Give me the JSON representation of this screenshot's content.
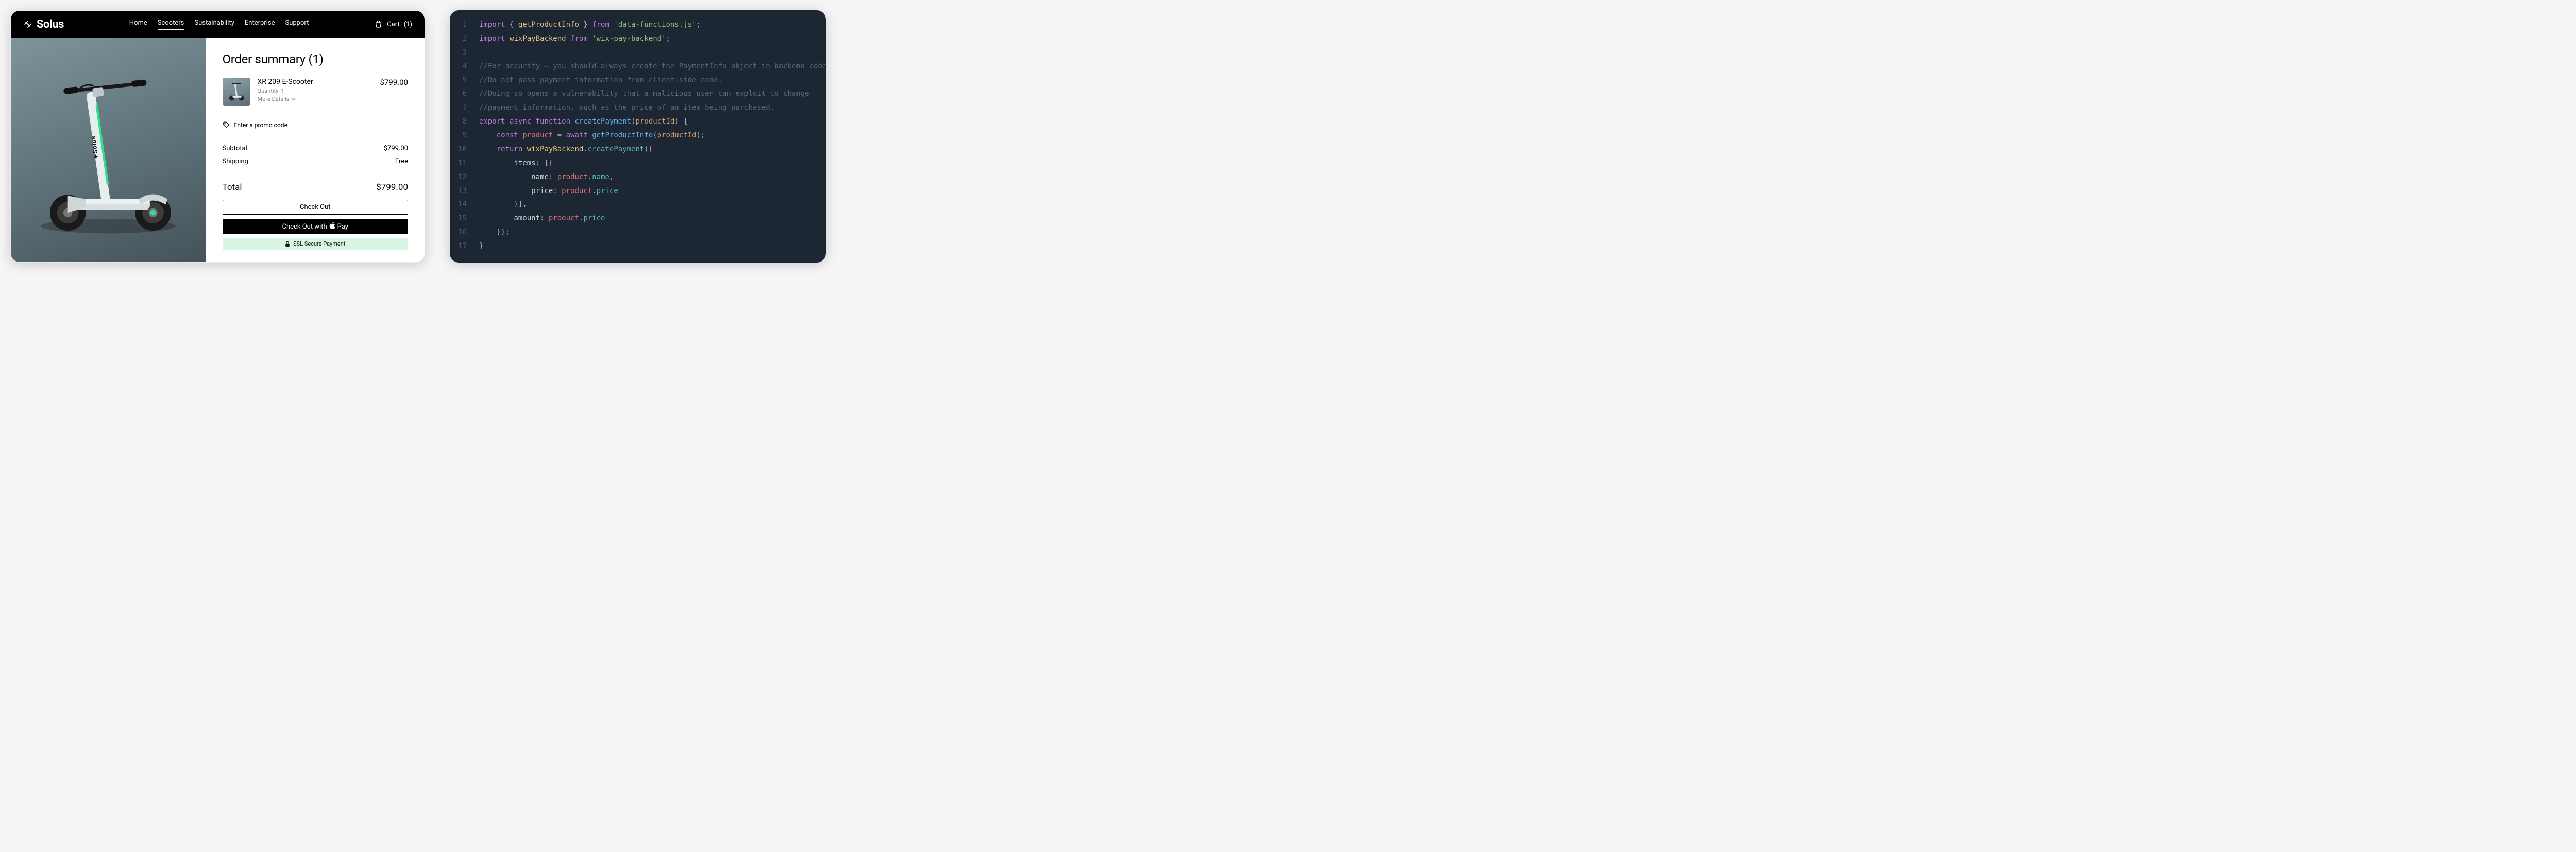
{
  "storefront": {
    "brand": "Solus",
    "nav": {
      "items": [
        "Home",
        "Scooters",
        "Sustainability",
        "Enterprise",
        "Support"
      ],
      "active_index": 1
    },
    "cart": {
      "label": "Cart",
      "count": "(1)"
    },
    "order_summary": {
      "title": "Order summary (1)",
      "item": {
        "name": "XR 209 E-Scooter",
        "quantity_label": "Quantity: 1",
        "more_details": "More Details",
        "price": "$799.00"
      },
      "promo_label": "Enter a promo code",
      "subtotal_label": "Subtotal",
      "subtotal_value": "$799.00",
      "shipping_label": "Shipping",
      "shipping_value": "Free",
      "total_label": "Total",
      "total_value": "$799.00",
      "checkout_label": "Check Out",
      "checkout_apple_prefix": "Check Out with ",
      "checkout_apple_suffix": "Pay",
      "ssl_label": "SSL Secure Payment"
    }
  },
  "editor": {
    "lines": [
      {
        "n": 1,
        "tokens": [
          [
            "kw",
            "import"
          ],
          [
            "punc",
            " { "
          ],
          [
            "id",
            "getProductInfo"
          ],
          [
            "punc",
            " } "
          ],
          [
            "kw2",
            "from"
          ],
          [
            "punc",
            " "
          ],
          [
            "str",
            "'data-functions.js'"
          ],
          [
            "punc",
            ";"
          ]
        ]
      },
      {
        "n": 2,
        "tokens": [
          [
            "kw",
            "import"
          ],
          [
            "punc",
            " "
          ],
          [
            "id",
            "wixPayBackend"
          ],
          [
            "punc",
            " "
          ],
          [
            "kw2",
            "from"
          ],
          [
            "punc",
            " "
          ],
          [
            "str",
            "'wix-pay-backend'"
          ],
          [
            "punc",
            ";"
          ]
        ]
      },
      {
        "n": 3,
        "tokens": []
      },
      {
        "n": 4,
        "tokens": [
          [
            "cmt",
            "//For security – you should always create the PaymentInfo object in backend code."
          ]
        ]
      },
      {
        "n": 5,
        "tokens": [
          [
            "cmt",
            "//Do not pass payment information from client-side code."
          ]
        ]
      },
      {
        "n": 6,
        "tokens": [
          [
            "cmt",
            "//Doing so opens a vulnerability that a malicious user can exploit to change"
          ]
        ]
      },
      {
        "n": 7,
        "tokens": [
          [
            "cmt",
            "//payment information, such as the price of an item being purchased."
          ]
        ]
      },
      {
        "n": 8,
        "tokens": [
          [
            "kw",
            "export"
          ],
          [
            "punc",
            " "
          ],
          [
            "kw2",
            "async"
          ],
          [
            "punc",
            " "
          ],
          [
            "kw",
            "function"
          ],
          [
            "punc",
            " "
          ],
          [
            "fn",
            "createPayment"
          ],
          [
            "punc",
            "("
          ],
          [
            "param",
            "productId"
          ],
          [
            "punc",
            ") {"
          ]
        ]
      },
      {
        "n": 9,
        "tokens": [
          [
            "punc",
            "    "
          ],
          [
            "kw",
            "const"
          ],
          [
            "punc",
            " "
          ],
          [
            "var",
            "product"
          ],
          [
            "punc",
            " = "
          ],
          [
            "kw2",
            "await"
          ],
          [
            "punc",
            " "
          ],
          [
            "fn",
            "getProductInfo"
          ],
          [
            "punc",
            "("
          ],
          [
            "param",
            "productId"
          ],
          [
            "punc",
            ");"
          ]
        ]
      },
      {
        "n": 10,
        "tokens": [
          [
            "punc",
            "    "
          ],
          [
            "kw",
            "return"
          ],
          [
            "punc",
            " "
          ],
          [
            "id",
            "wixPayBackend"
          ],
          [
            "punc",
            "."
          ],
          [
            "prop",
            "createPayment"
          ],
          [
            "punc",
            "({"
          ]
        ]
      },
      {
        "n": 11,
        "tokens": [
          [
            "punc",
            "        "
          ],
          [
            "key",
            "items"
          ],
          [
            "punc",
            ": [{"
          ]
        ]
      },
      {
        "n": 12,
        "tokens": [
          [
            "punc",
            "            "
          ],
          [
            "key",
            "name"
          ],
          [
            "punc",
            ": "
          ],
          [
            "var",
            "product"
          ],
          [
            "punc",
            "."
          ],
          [
            "prop",
            "name"
          ],
          [
            "punc",
            ","
          ]
        ]
      },
      {
        "n": 13,
        "tokens": [
          [
            "punc",
            "            "
          ],
          [
            "key",
            "price"
          ],
          [
            "punc",
            ": "
          ],
          [
            "var",
            "product"
          ],
          [
            "punc",
            "."
          ],
          [
            "prop",
            "price"
          ]
        ]
      },
      {
        "n": 14,
        "tokens": [
          [
            "punc",
            "        }],"
          ]
        ]
      },
      {
        "n": 15,
        "tokens": [
          [
            "punc",
            "        "
          ],
          [
            "key",
            "amount"
          ],
          [
            "punc",
            ": "
          ],
          [
            "var",
            "product"
          ],
          [
            "punc",
            "."
          ],
          [
            "prop",
            "price"
          ]
        ]
      },
      {
        "n": 16,
        "tokens": [
          [
            "punc",
            "    });"
          ]
        ]
      },
      {
        "n": 17,
        "tokens": [
          [
            "punc",
            "}"
          ]
        ]
      }
    ]
  }
}
